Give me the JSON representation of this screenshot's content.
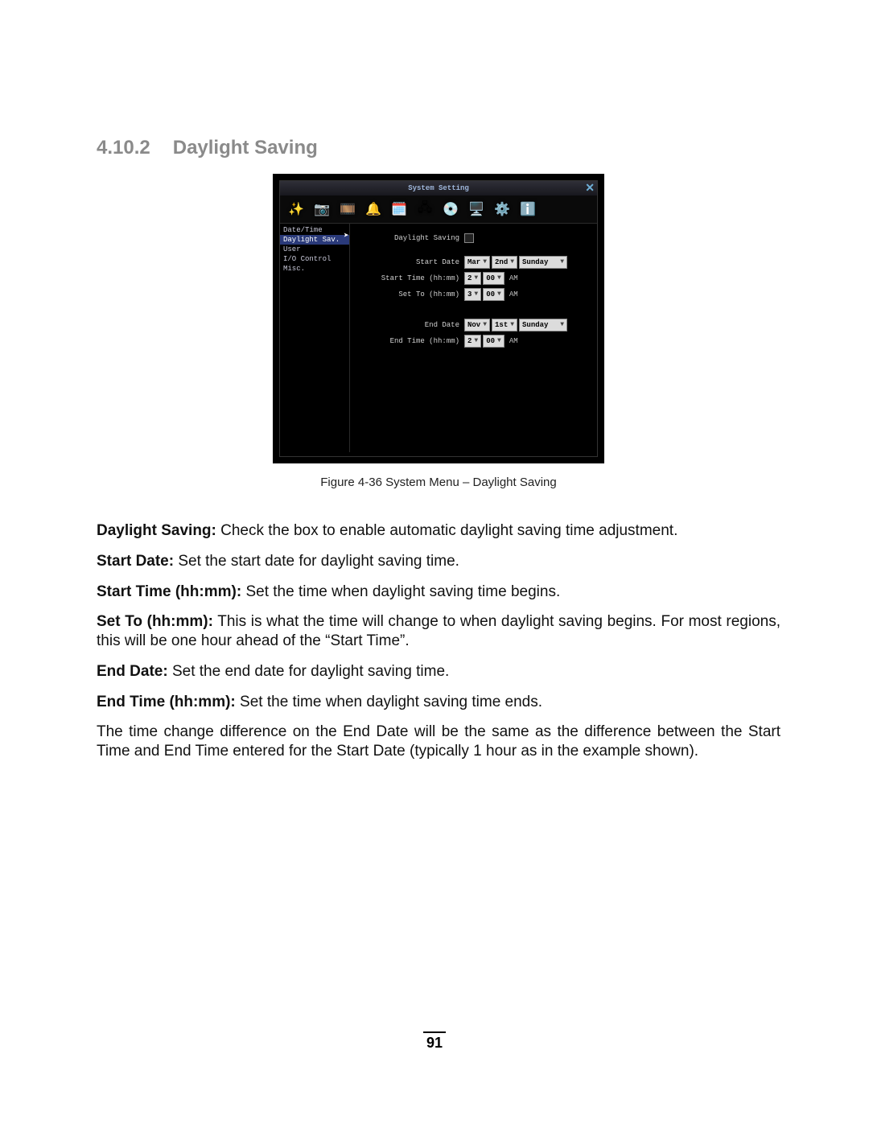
{
  "heading": {
    "num": "4.10.2",
    "title": "Daylight Saving"
  },
  "screenshot": {
    "window_title": "System Setting",
    "close_glyph": "✕",
    "toolbar_icons": [
      "wand",
      "camera",
      "film",
      "bell",
      "schedule",
      "network",
      "disc",
      "monitor",
      "gears",
      "info"
    ],
    "sidebar": {
      "items": [
        "Date/Time",
        "Daylight Sav.",
        "User",
        "I/O Control",
        "Misc."
      ],
      "selected_index": 1
    },
    "form": {
      "enable_label": "Daylight Saving",
      "start_date_label": "Start Date",
      "start_date": {
        "month": "Mar",
        "ordinal": "2nd",
        "weekday": "Sunday"
      },
      "start_time_label": "Start Time (hh:mm)",
      "start_time": {
        "hh": "2",
        "mm": "00",
        "ampm": "AM"
      },
      "set_to_label": "Set To (hh:mm)",
      "set_to": {
        "hh": "3",
        "mm": "00",
        "ampm": "AM"
      },
      "end_date_label": "End Date",
      "end_date": {
        "month": "Nov",
        "ordinal": "1st",
        "weekday": "Sunday"
      },
      "end_time_label": "End Time (hh:mm)",
      "end_time": {
        "hh": "2",
        "mm": "00",
        "ampm": "AM"
      }
    }
  },
  "figure_caption": "Figure 4-36   System Menu – Daylight Saving",
  "body": {
    "p1_b": "Daylight Saving:",
    "p1_t": " Check the box to enable automatic daylight saving time adjustment.",
    "p2_b": "Start Date:",
    "p2_t": " Set the start date for daylight saving time.",
    "p3_b": "Start Time (hh:mm):",
    "p3_t": " Set the time when daylight saving time begins.",
    "p4_b": "Set To (hh:mm):",
    "p4_t": " This is what the time will change to when daylight saving begins. For most regions, this will be one hour ahead of the “Start Time”.",
    "p5_b": "End Date:",
    "p5_t": " Set the end date for daylight saving time.",
    "p6_b": "End Time (hh:mm):",
    "p6_t": " Set the time when daylight saving time ends.",
    "p7": "The time change difference on the End Date will be the same as the difference between the Start Time and End Time entered for the Start Date (typically 1 hour as in the example shown)."
  },
  "page_number": "91",
  "icon_glyphs": {
    "wand": "✨",
    "camera": "📷",
    "film": "🎞️",
    "bell": "🔔",
    "schedule": "🗓️",
    "network": "🖧",
    "disc": "💿",
    "monitor": "🖥️",
    "gears": "⚙️",
    "info": "ℹ️"
  }
}
